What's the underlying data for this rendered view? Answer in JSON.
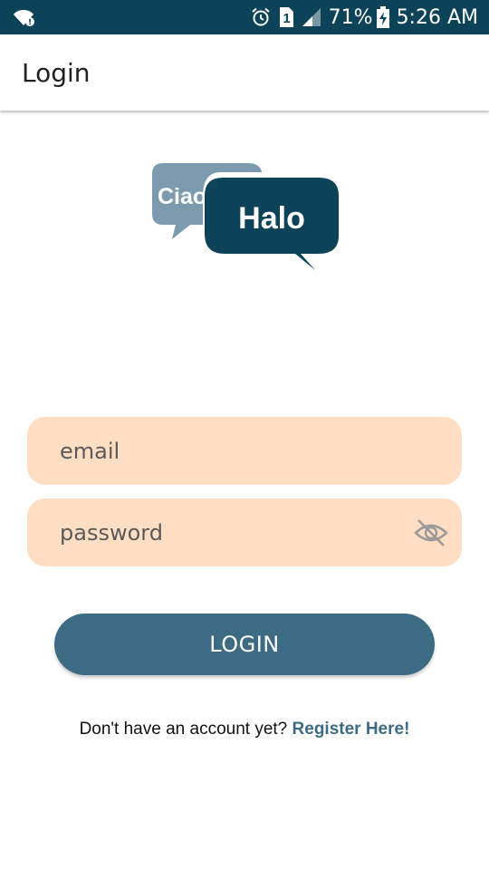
{
  "status_bar": {
    "battery": "71%",
    "time": "5:26 AM",
    "sim_slot": "1",
    "bg_color": "#0d4358",
    "icons": [
      "wifi-info-icon",
      "alarm-icon",
      "sim-icon",
      "signal-icon",
      "battery-charging-icon"
    ]
  },
  "app_bar": {
    "title": "Login"
  },
  "logo": {
    "back_bubble_text": "Ciao",
    "front_bubble_text": "Halo",
    "back_color": "#7c9bae",
    "front_color": "#0d4358"
  },
  "form": {
    "email_placeholder": "email",
    "password_placeholder": "password",
    "field_color": "#ffdec3",
    "password_toggle_icon": "eye-off-icon"
  },
  "login_button": {
    "label": "LOGIN",
    "color": "#3d6b84"
  },
  "register": {
    "prompt": "Don't have an account yet?",
    "link": "Register Here!"
  }
}
